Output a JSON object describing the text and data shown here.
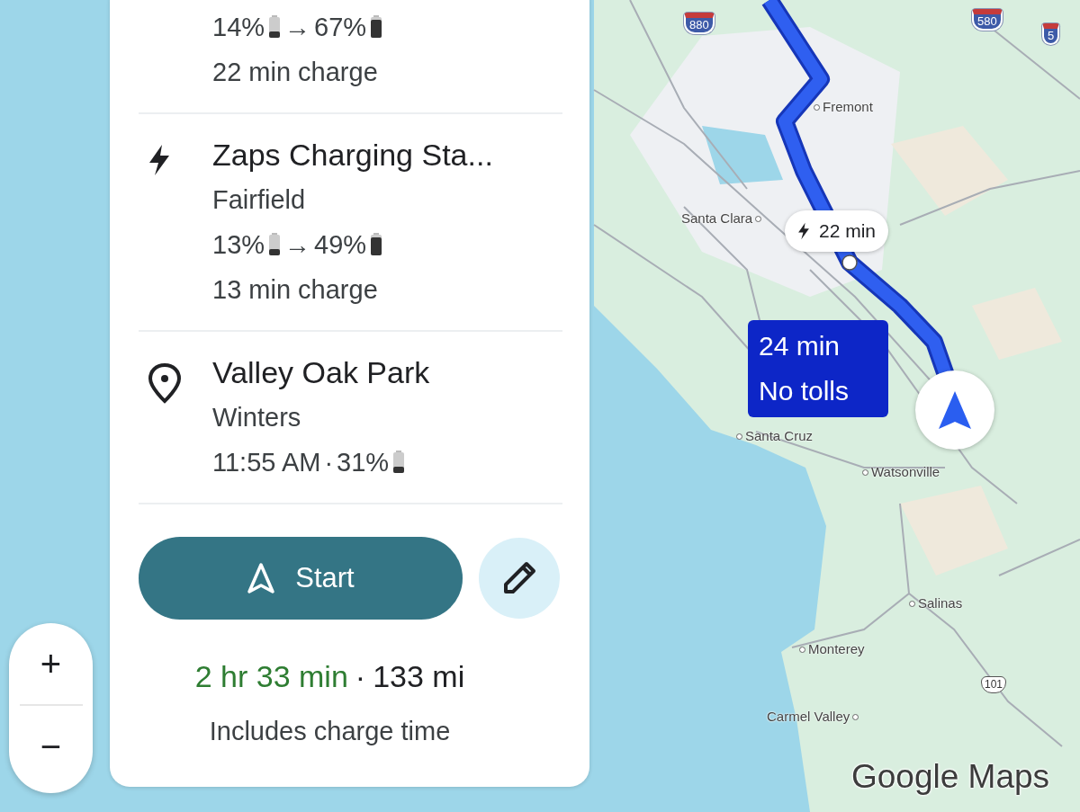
{
  "route_panel": {
    "stops": [
      {
        "kind": "charging_partial",
        "charge": {
          "from": "14%",
          "arrow": "→",
          "to": "67%"
        },
        "duration": "22 min charge"
      },
      {
        "kind": "charging",
        "name": "Zaps Charging Sta...",
        "place": "Fairfield",
        "charge": {
          "from": "13%",
          "arrow": "→",
          "to": "49%"
        },
        "duration": "13 min charge"
      },
      {
        "kind": "destination",
        "name": "Valley Oak Park",
        "place": "Winters",
        "arrival": {
          "time": "11:55 AM",
          "separator": "·",
          "battery": "31%"
        }
      }
    ],
    "start_button": {
      "label": "Start"
    },
    "summary": {
      "duration": "2 hr 33 min",
      "separator": "·",
      "distance": "133 mi",
      "note": "Includes charge time"
    }
  },
  "zoom_controls": {
    "zoom_in": "+",
    "zoom_out": "−"
  },
  "map": {
    "labels": [
      {
        "kind": "shield_interstate",
        "text": "880"
      },
      {
        "kind": "shield_interstate",
        "text": "580"
      },
      {
        "kind": "shield_interstate",
        "text": "5"
      },
      {
        "kind": "town_dot_before",
        "text": "Fremont"
      },
      {
        "kind": "town_dot_after",
        "text": "Santa Clara"
      },
      {
        "kind": "town_dot_before",
        "text": "Santa Cruz"
      },
      {
        "kind": "town_dot_before",
        "text": "Watsonville"
      },
      {
        "kind": "town_dot_before",
        "text": "Salinas"
      },
      {
        "kind": "town_dot_before",
        "text": "Monterey"
      },
      {
        "kind": "town_dot_after",
        "text": "Carmel Valley"
      },
      {
        "kind": "shield_us",
        "text": "101"
      }
    ],
    "charge_callout": {
      "text": "22 min"
    },
    "route_callout": {
      "lines": [
        "24 min",
        "No tolls"
      ]
    },
    "logo": "Google Maps"
  }
}
